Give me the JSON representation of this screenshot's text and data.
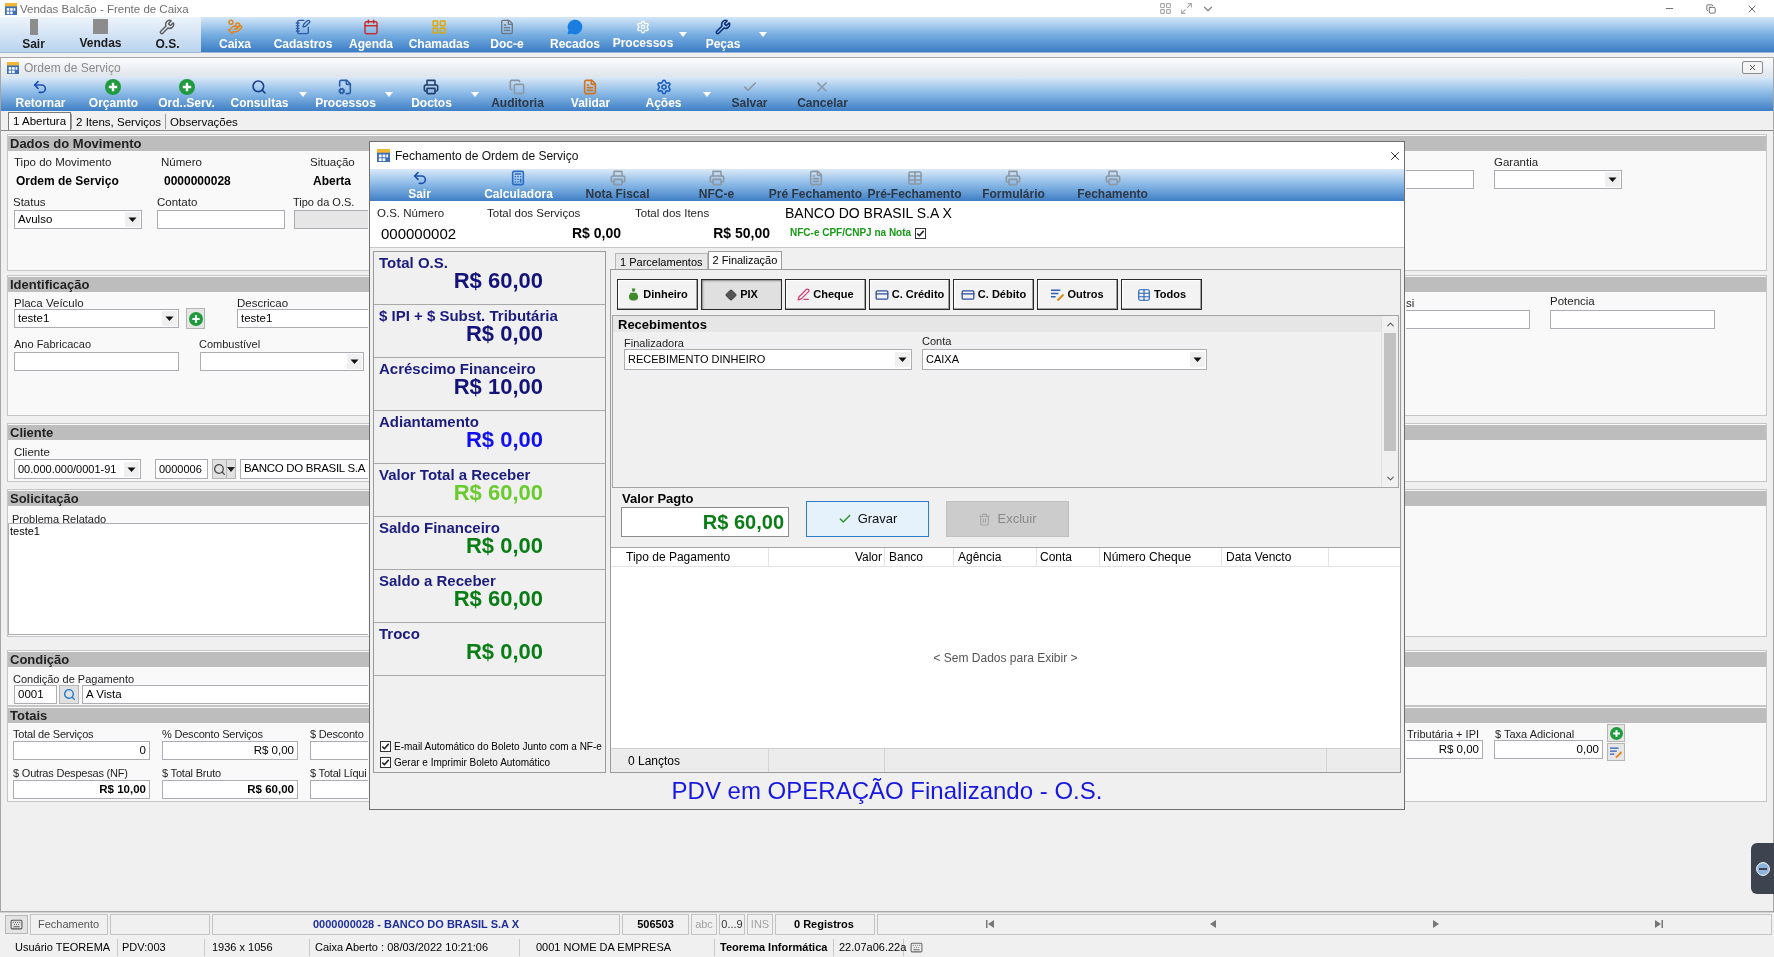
{
  "app_window": {
    "title": "Vendas Balcão - Frente de Caixa"
  },
  "main_toolbar": {
    "left_items": [
      {
        "label": "Sair"
      },
      {
        "label": "Vendas"
      },
      {
        "label": "O.S."
      }
    ],
    "items": [
      {
        "label": "Caixa",
        "dropdown": false
      },
      {
        "label": "Cadastros",
        "dropdown": false
      },
      {
        "label": "Agenda",
        "dropdown": false
      },
      {
        "label": "Chamadas",
        "dropdown": false
      },
      {
        "label": "Doc-e",
        "dropdown": false
      },
      {
        "label": "Recados",
        "dropdown": false
      },
      {
        "label": "Processos",
        "dropdown": true
      },
      {
        "label": "Peças",
        "dropdown": true
      }
    ]
  },
  "os_window": {
    "title": "Ordem de Serviço",
    "toolbar": [
      {
        "label": "Retornar",
        "disabled": false,
        "dropdown": false
      },
      {
        "label": "Orçamto",
        "disabled": false,
        "dropdown": false
      },
      {
        "label": "Ord..Serv.",
        "disabled": false,
        "dropdown": false
      },
      {
        "label": "Consultas",
        "disabled": false,
        "dropdown": true
      },
      {
        "label": "Processos",
        "disabled": false,
        "dropdown": true
      },
      {
        "label": "Doctos",
        "disabled": false,
        "dropdown": true
      },
      {
        "label": "Auditoria",
        "disabled": true,
        "dropdown": false
      },
      {
        "label": "Validar",
        "disabled": false,
        "dropdown": false
      },
      {
        "label": "Ações",
        "disabled": false,
        "dropdown": true
      },
      {
        "label": "Salvar",
        "disabled": true,
        "dropdown": false
      },
      {
        "label": "Cancelar",
        "disabled": true,
        "dropdown": false
      }
    ],
    "tabs": [
      {
        "label": "1 Abertura",
        "selected": true
      },
      {
        "label": "2 Itens, Serviços",
        "selected": false
      },
      {
        "label": "Observações",
        "selected": false
      }
    ],
    "dados_do_movimento": {
      "heading": "Dados do Movimento",
      "tipo_do_movimento": {
        "label": "Tipo do Movimento",
        "value": "Ordem de Serviço"
      },
      "numero": {
        "label": "Número",
        "value": "0000000028"
      },
      "situacao": {
        "label": "Situação",
        "value": "Aberta"
      },
      "status": {
        "label": "Status",
        "value": "Avulso"
      },
      "contato": {
        "label": "Contato"
      },
      "tipo_da_os": {
        "label": "Tipo da O.S.",
        "disabled": true
      },
      "garantia": {
        "label": "Garantia"
      }
    },
    "identificacao": {
      "heading": "Identificação",
      "placa_veiculo": {
        "label": "Placa Veículo",
        "value": "teste1"
      },
      "descricao": {
        "label": "Descricao",
        "value": "teste1"
      },
      "ano_fabricacao": {
        "label": "Ano Fabricacao"
      },
      "combustivel": {
        "label": "Combustível"
      },
      "partial_field": {
        "label": "si"
      },
      "potencia": {
        "label": "Potencia"
      }
    },
    "cliente": {
      "heading": "Cliente",
      "label": "Cliente",
      "document": "00.000.000/0001-91",
      "code": "0000006",
      "name": "BANCO DO BRASIL S.A"
    },
    "solicitacao": {
      "heading": "Solicitação",
      "label": "Problema Relatado",
      "value": "teste1"
    },
    "condicao": {
      "heading": "Condição",
      "label": "Condição de Pagamento",
      "code": "0001",
      "description": "A Vista"
    },
    "totais": {
      "heading": "Totais",
      "row_1": [
        {
          "label": "Total de Serviços",
          "value": "0",
          "bold": false
        },
        {
          "label": "% Desconto Serviços",
          "value": "R$ 0,00",
          "bold": false
        },
        {
          "label": "$ Desconto"
        }
      ],
      "row_2": [
        {
          "label": "$ Outras Despesas (NF)",
          "value": "R$ 10,00",
          "bold": true
        },
        {
          "label": "$ Total Bruto",
          "value": "R$ 60,00",
          "bold": true
        },
        {
          "label": "$ Total Líqui"
        }
      ],
      "right": [
        {
          "label": "Tributária + IPI",
          "value": "R$ 0,00",
          "bold": false
        },
        {
          "label": "$ Taxa Adicional",
          "value": "0,00",
          "bold": false
        }
      ]
    }
  },
  "closing_dialog": {
    "title": "Fechamento de Ordem de Serviço",
    "toolbar": [
      {
        "label": "Sair",
        "disabled": false
      },
      {
        "label": "Calculadora",
        "disabled": false
      },
      {
        "label": "Nota Fiscal",
        "disabled": true
      },
      {
        "label": "NFC-e",
        "disabled": true
      },
      {
        "label": "Pré Fechamento",
        "disabled": true
      },
      {
        "label": "Pré-Fechamento",
        "disabled": true
      },
      {
        "label": "Formulário",
        "disabled": true
      },
      {
        "label": "Fechamento",
        "disabled": true
      }
    ],
    "summary": {
      "os_number": {
        "label": "O.S. Número",
        "value": "000000002"
      },
      "services_total": {
        "label": "Total dos Serviços",
        "value": "R$ 0,00"
      },
      "items_total": {
        "label": "Total dos Itens",
        "value": "R$ 50,00"
      },
      "customer": "BANCO DO BRASIL S.A X",
      "nfce_option": {
        "label": "NFC-e CPF/CNPJ na Nota",
        "checked": true
      }
    },
    "totals": [
      {
        "label": "Total O.S.",
        "value": "R$ 60,00",
        "color": "#13137a"
      },
      {
        "label": "$ IPI + $ Subst. Tributária",
        "value": "R$ 0,00",
        "color": "#13137a"
      },
      {
        "label": "Acréscimo Financeiro",
        "value": "R$ 10,00",
        "color": "#13137a"
      },
      {
        "label": "Adiantamento",
        "value": "R$ 0,00",
        "color": "#1010ee"
      },
      {
        "label": "Valor Total a Receber",
        "value": "R$ 60,00",
        "color": "#6acb2e"
      },
      {
        "label": "Saldo Financeiro",
        "value": "R$ 0,00",
        "color": "#0b7d16"
      },
      {
        "label": "Saldo a Receber",
        "value": "R$ 60,00",
        "color": "#0b7d16"
      },
      {
        "label": "Troco",
        "value": "R$ 0,00",
        "color": "#0b7d16"
      }
    ],
    "options": [
      {
        "label": "E-mail Automático do Boleto Junto com a NF-e",
        "checked": true
      },
      {
        "label": "Gerar e Imprimir Boleto Automático",
        "checked": true
      }
    ],
    "tabs": [
      {
        "label": "1 Parcelamentos",
        "selected": false
      },
      {
        "label": "2 Finalização",
        "selected": true
      }
    ],
    "payment_methods": [
      {
        "label": "Dinheiro",
        "selected": false
      },
      {
        "label": "PIX",
        "selected": true
      },
      {
        "label": "Cheque",
        "selected": false
      },
      {
        "label": "C. Crédito",
        "selected": false
      },
      {
        "label": "C. Débito",
        "selected": false
      },
      {
        "label": "Outros",
        "selected": false
      },
      {
        "label": "Todos",
        "selected": false
      }
    ],
    "receipts": {
      "heading": "Recebimentos",
      "finalizadora": {
        "label": "Finalizadora",
        "value": "RECEBIMENTO DINHEIRO"
      },
      "conta": {
        "label": "Conta",
        "value": "CAIXA"
      }
    },
    "amount_paid": {
      "label": "Valor Pagto",
      "value": "R$ 60,00"
    },
    "buttons": [
      {
        "label": "Gravar",
        "disabled": false
      },
      {
        "label": "Excluir",
        "disabled": true
      }
    ],
    "payments_table": {
      "columns": [
        "Tipo de Pagamento",
        "Valor",
        "Banco",
        "Agência",
        "Conta",
        "Número Cheque",
        "Data Vencto"
      ],
      "empty_message": "< Sem Dados para Exibir >",
      "footer": "0 Lançtos"
    },
    "status_message": "PDV em OPERAÇÃO Finalizando - O.S."
  },
  "record_bar": {
    "mode": "Fechamento",
    "record": "0000000028 - BANCO DO BRASIL S.A X",
    "code": "506503",
    "indicators": [
      {
        "text": "abc",
        "active": false
      },
      {
        "text": "0...9",
        "active": true
      },
      {
        "text": "INS",
        "active": false
      }
    ],
    "count": "0 Registros"
  },
  "status_bar": [
    {
      "text": "Usuário TEOREMA",
      "bold": false
    },
    {
      "text": "PDV:003",
      "bold": false
    },
    {
      "text": "1936 x 1056",
      "bold": false
    },
    {
      "text": "Caixa Aberto : 08/03/2022 10:21:06",
      "bold": false
    },
    {
      "text": "0001 NOME DA EMPRESA",
      "bold": false
    },
    {
      "text": "Teorema Informática",
      "bold": true
    },
    {
      "text": "22.07a06.22a",
      "bold": false
    }
  ]
}
